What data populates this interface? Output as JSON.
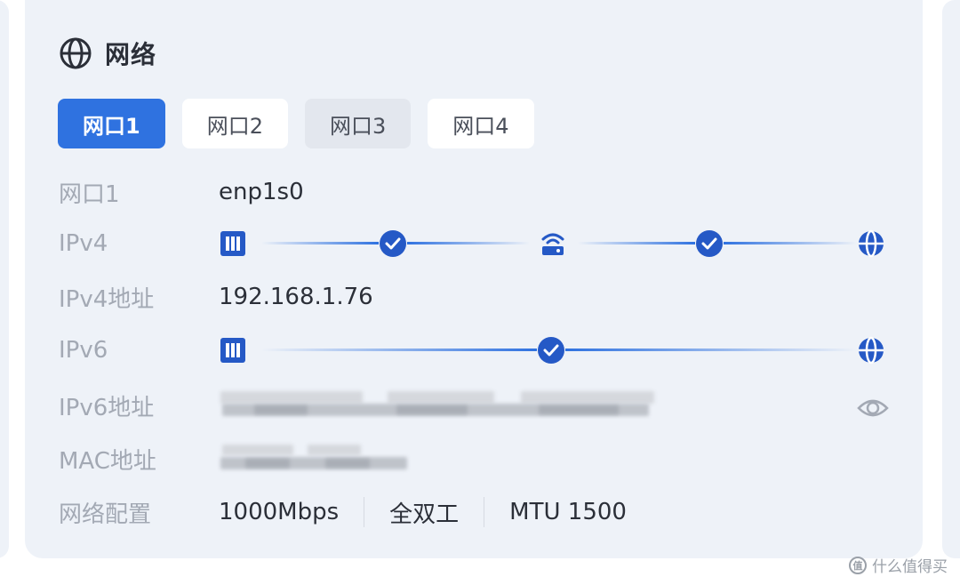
{
  "header": {
    "icon": "globe-icon",
    "title": "网络"
  },
  "tabs": [
    {
      "label": "网口1",
      "state": "active"
    },
    {
      "label": "网口2",
      "state": "normal"
    },
    {
      "label": "网口3",
      "state": "hover"
    },
    {
      "label": "网口4",
      "state": "normal"
    }
  ],
  "rows": {
    "port": {
      "label": "网口1",
      "value": "enp1s0"
    },
    "ipv4": {
      "label": "IPv4",
      "status": [
        "device",
        "ok",
        "router",
        "ok",
        "internet"
      ]
    },
    "ipv4_addr": {
      "label": "IPv4地址",
      "value": "192.168.1.76"
    },
    "ipv6": {
      "label": "IPv6",
      "status": [
        "device",
        "ok",
        "internet"
      ]
    },
    "ipv6_addr": {
      "label": "IPv6地址",
      "value_hidden": true,
      "reveal_icon": "eye-icon"
    },
    "mac_addr": {
      "label": "MAC地址",
      "value_hidden": true
    },
    "config": {
      "label": "网络配置",
      "speed": "1000Mbps",
      "duplex": "全双工",
      "mtu": "MTU 1500"
    }
  },
  "colors": {
    "accent": "#2f72e0",
    "status_ok": "#2559c6",
    "card_bg": "#eef2f8"
  },
  "watermark": {
    "text": "什么值得买"
  }
}
